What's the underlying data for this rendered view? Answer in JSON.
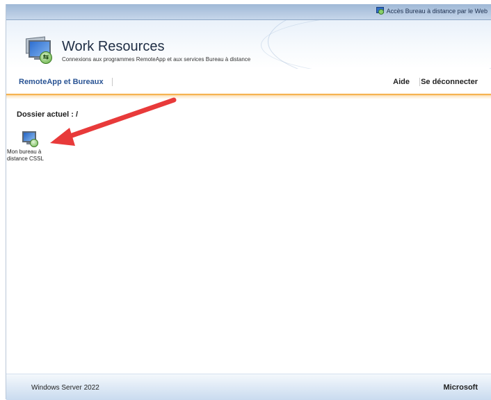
{
  "top_strip": {
    "rd_web_link": "Accès Bureau à distance par le Web"
  },
  "header": {
    "title": "Work Resources",
    "subtitle": "Connexions aux programmes RemoteApp et aux services Bureau à distance"
  },
  "nav": {
    "remoteapp_label": "RemoteApp et Bureaux",
    "help_label": "Aide",
    "logout_label": "Se déconnecter"
  },
  "content": {
    "current_folder": "Dossier actuel : /",
    "items": [
      {
        "label": "Mon bureau à distance CSSL",
        "icon": "remote-desktop-icon"
      }
    ]
  },
  "annotation": {
    "arrow_color": "#e83a3a"
  },
  "footer": {
    "left_text": "Windows Server 2022",
    "right_text": "Microsoft"
  },
  "colors": {
    "accent_orange": "#f39a1c",
    "nav_blue": "#2a5494"
  }
}
